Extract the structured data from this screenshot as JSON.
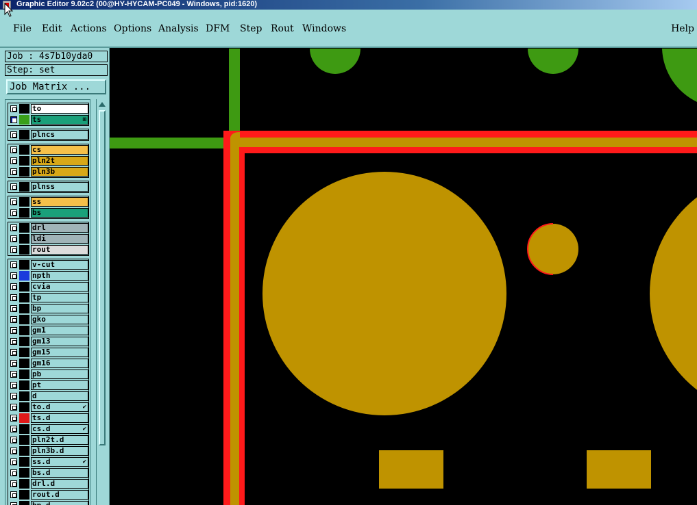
{
  "window": {
    "title": "Graphic Editor 9.02c2 (00@HY-HYCAM-PC049 - Windows, pid:1620)"
  },
  "menu": {
    "items": [
      "File",
      "Edit",
      "Actions",
      "Options",
      "Analysis",
      "DFM",
      "Step",
      "Rout",
      "Windows"
    ],
    "help": "Help"
  },
  "panel": {
    "job": "Job : 4s7b10yda0",
    "step": "Step: set",
    "job_matrix": "Job Matrix ..."
  },
  "layers": [
    {
      "name": "to",
      "swatch": "#000000",
      "bg": "#ffffff",
      "checked": false,
      "group": 0
    },
    {
      "name": "ts",
      "swatch": "#3aa01a",
      "bg": "#1aa07a",
      "checked": true,
      "group": 0,
      "mark": "⊞"
    },
    {
      "name": "plncs",
      "swatch": "#000000",
      "bg": "#9ed8d8",
      "checked": false,
      "group": 1
    },
    {
      "name": "cs",
      "swatch": "#000000",
      "bg": "#f5c04a",
      "checked": false,
      "group": 2
    },
    {
      "name": "pln2t",
      "swatch": "#000000",
      "bg": "#d8a818",
      "checked": false,
      "group": 2
    },
    {
      "name": "pln3b",
      "swatch": "#000000",
      "bg": "#d8a818",
      "checked": false,
      "group": 2
    },
    {
      "name": "plnss",
      "swatch": "#000000",
      "bg": "#9ed8d8",
      "checked": false,
      "group": 3
    },
    {
      "name": "ss",
      "swatch": "#000000",
      "bg": "#f5c04a",
      "checked": false,
      "group": 4
    },
    {
      "name": "bs",
      "swatch": "#000000",
      "bg": "#1aa07a",
      "checked": false,
      "group": 4
    },
    {
      "name": "drl",
      "swatch": "#000000",
      "bg": "#a0b4b8",
      "checked": false,
      "group": 5
    },
    {
      "name": "ldi",
      "swatch": "#000000",
      "bg": "#a0b4b8",
      "checked": false,
      "group": 5
    },
    {
      "name": "rout",
      "swatch": "#000000",
      "bg": "#dcdcdc",
      "checked": false,
      "group": 5
    },
    {
      "name": "v-cut",
      "swatch": "#000000",
      "bg": "#9ed8d8",
      "checked": false,
      "group": 6
    },
    {
      "name": "npth",
      "swatch": "#1a3adc",
      "bg": "#9ed8d8",
      "checked": false,
      "group": 6
    },
    {
      "name": "cvia",
      "swatch": "#000000",
      "bg": "#9ed8d8",
      "checked": false,
      "group": 6
    },
    {
      "name": "tp",
      "swatch": "#000000",
      "bg": "#9ed8d8",
      "checked": false,
      "group": 6
    },
    {
      "name": "bp",
      "swatch": "#000000",
      "bg": "#9ed8d8",
      "checked": false,
      "group": 6
    },
    {
      "name": "gko",
      "swatch": "#000000",
      "bg": "#9ed8d8",
      "checked": false,
      "group": 6
    },
    {
      "name": "gm1",
      "swatch": "#000000",
      "bg": "#9ed8d8",
      "checked": false,
      "group": 6
    },
    {
      "name": "gm13",
      "swatch": "#000000",
      "bg": "#9ed8d8",
      "checked": false,
      "group": 6
    },
    {
      "name": "gm15",
      "swatch": "#000000",
      "bg": "#9ed8d8",
      "checked": false,
      "group": 6
    },
    {
      "name": "gm16",
      "swatch": "#000000",
      "bg": "#9ed8d8",
      "checked": false,
      "group": 6
    },
    {
      "name": "pb",
      "swatch": "#000000",
      "bg": "#9ed8d8",
      "checked": false,
      "group": 6
    },
    {
      "name": "pt",
      "swatch": "#000000",
      "bg": "#9ed8d8",
      "checked": false,
      "group": 6
    },
    {
      "name": "d",
      "swatch": "#000000",
      "bg": "#9ed8d8",
      "checked": false,
      "group": 6
    },
    {
      "name": "to.d",
      "swatch": "#000000",
      "bg": "#9ed8d8",
      "checked": false,
      "group": 6,
      "mark": "✔"
    },
    {
      "name": "ts.d",
      "swatch": "#e01a1a",
      "bg": "#9ed8d8",
      "checked": false,
      "group": 6
    },
    {
      "name": "cs.d",
      "swatch": "#000000",
      "bg": "#9ed8d8",
      "checked": false,
      "group": 6,
      "mark": "✔"
    },
    {
      "name": "pln2t.d",
      "swatch": "#000000",
      "bg": "#9ed8d8",
      "checked": false,
      "group": 6
    },
    {
      "name": "pln3b.d",
      "swatch": "#000000",
      "bg": "#9ed8d8",
      "checked": false,
      "group": 6
    },
    {
      "name": "ss.d",
      "swatch": "#000000",
      "bg": "#9ed8d8",
      "checked": false,
      "group": 6,
      "mark": "✔"
    },
    {
      "name": "bs.d",
      "swatch": "#000000",
      "bg": "#9ed8d8",
      "checked": false,
      "group": 6
    },
    {
      "name": "drl.d",
      "swatch": "#000000",
      "bg": "#9ed8d8",
      "checked": false,
      "group": 6
    },
    {
      "name": "rout.d",
      "swatch": "#000000",
      "bg": "#9ed8d8",
      "checked": false,
      "group": 6
    },
    {
      "name": "bp.d",
      "swatch": "#000000",
      "bg": "#9ed8d8",
      "checked": false,
      "group": 6
    }
  ],
  "colors": {
    "panel": "#9ed8d8",
    "copper": "#bf9300",
    "green_layer": "#3e9a12",
    "red_layer": "#ff1a1a",
    "canvas_bg": "#000000"
  }
}
